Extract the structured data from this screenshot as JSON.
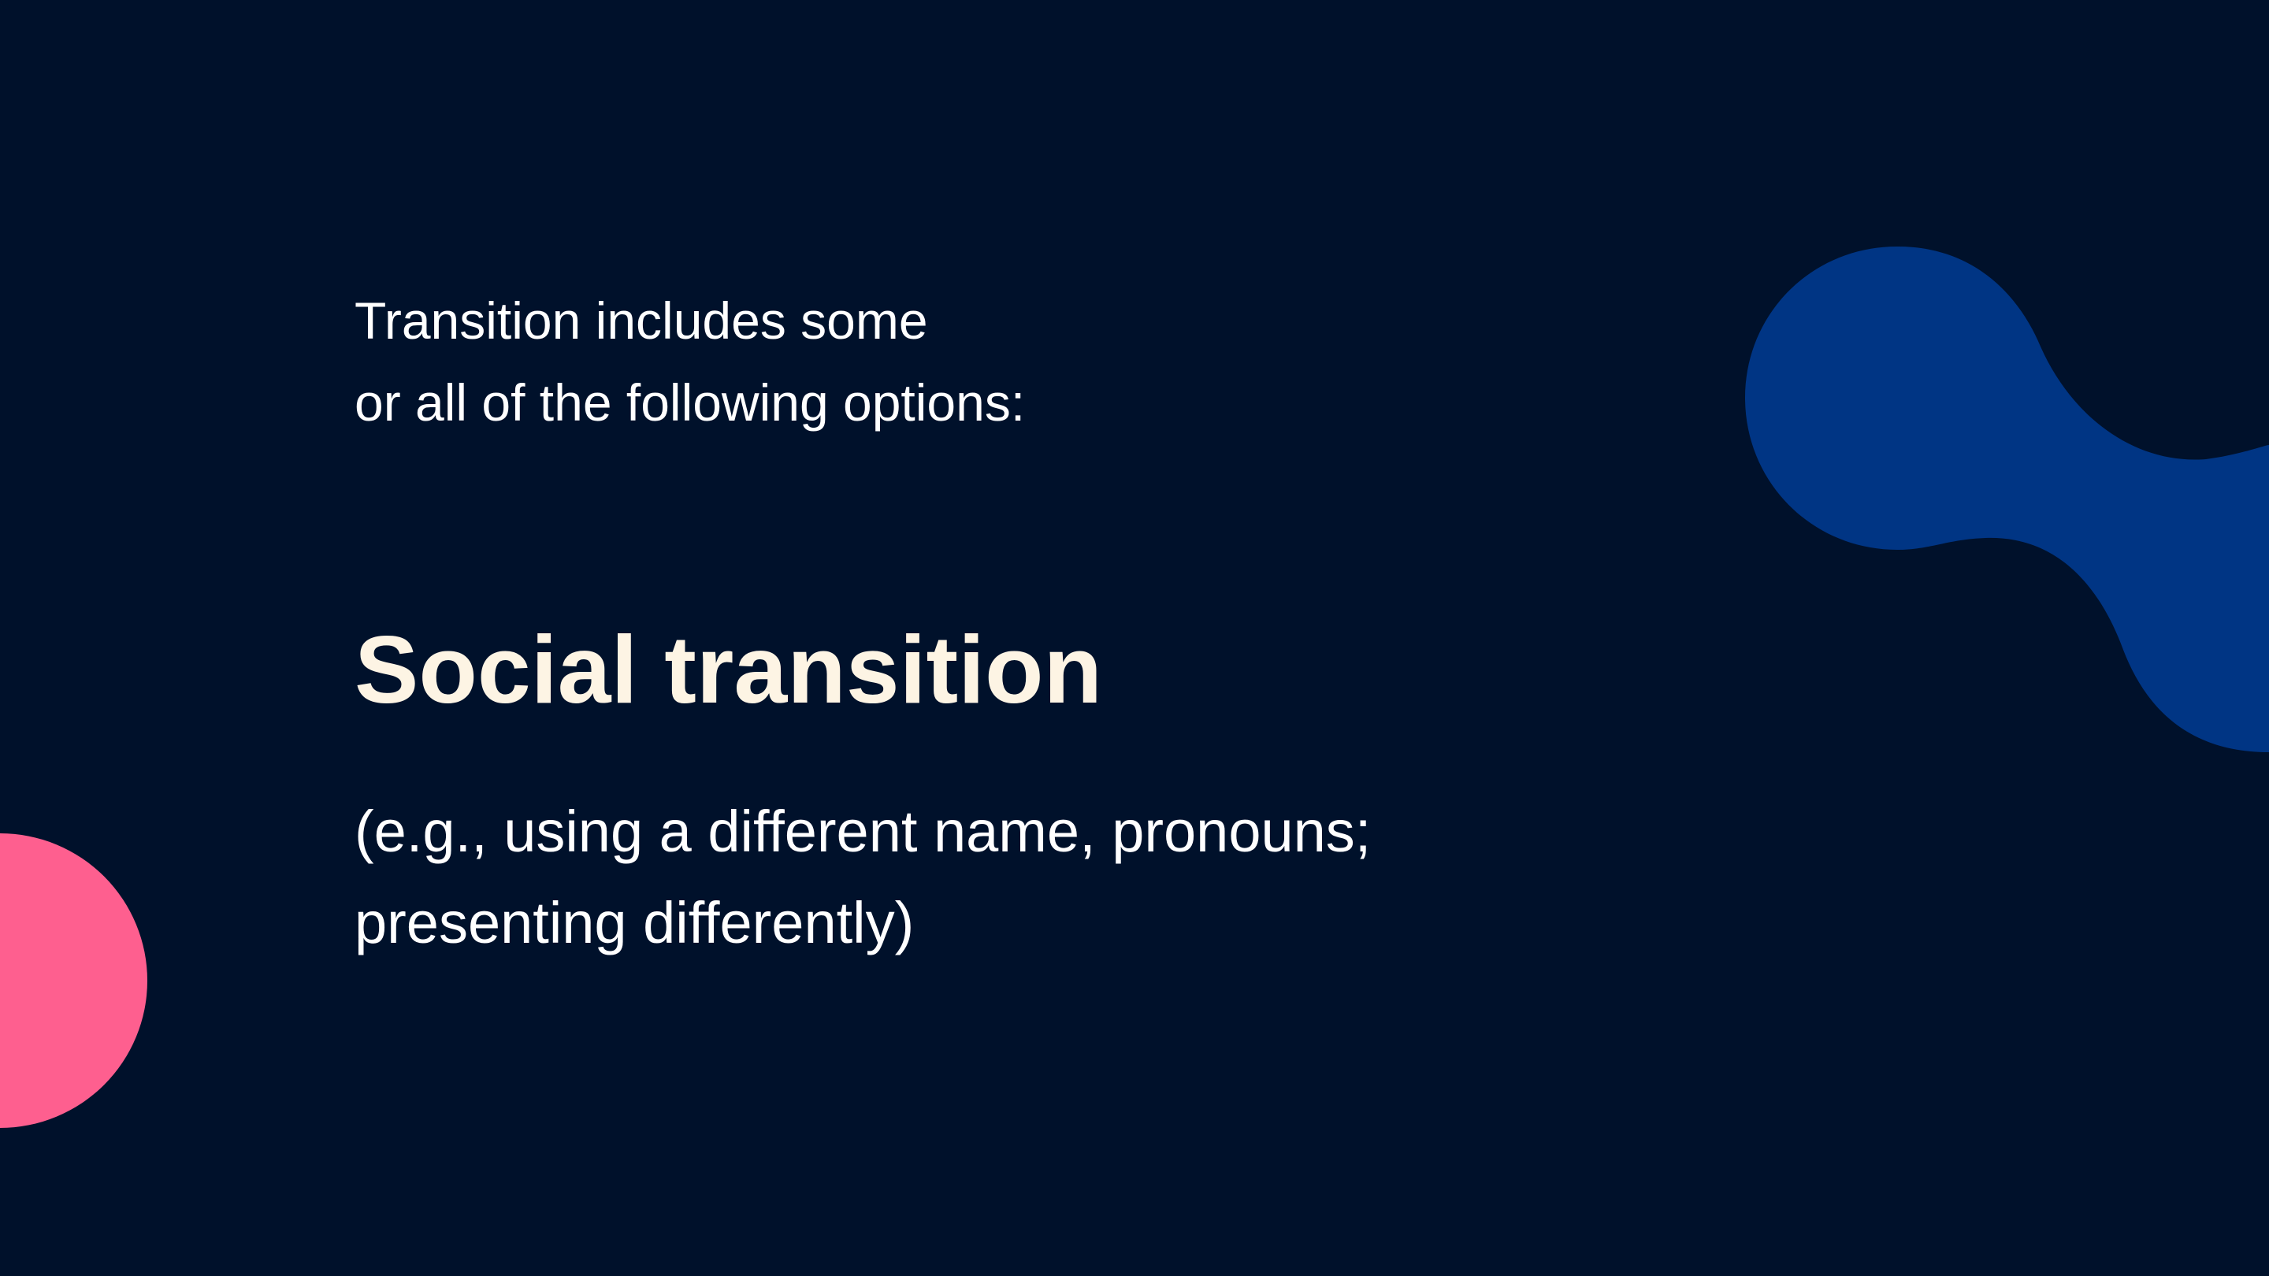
{
  "slide": {
    "intro_lines": [
      "Transition includes some",
      "or all of the following options:"
    ],
    "heading": "Social transition",
    "example_lines": [
      "(e.g., using a different name, pronouns;",
      "presenting differently)"
    ]
  },
  "colors": {
    "background": "#00112b",
    "text": "#ffffff",
    "heading": "#fdf4e4",
    "blob": "#003584",
    "circle": "#fe5f8f"
  }
}
